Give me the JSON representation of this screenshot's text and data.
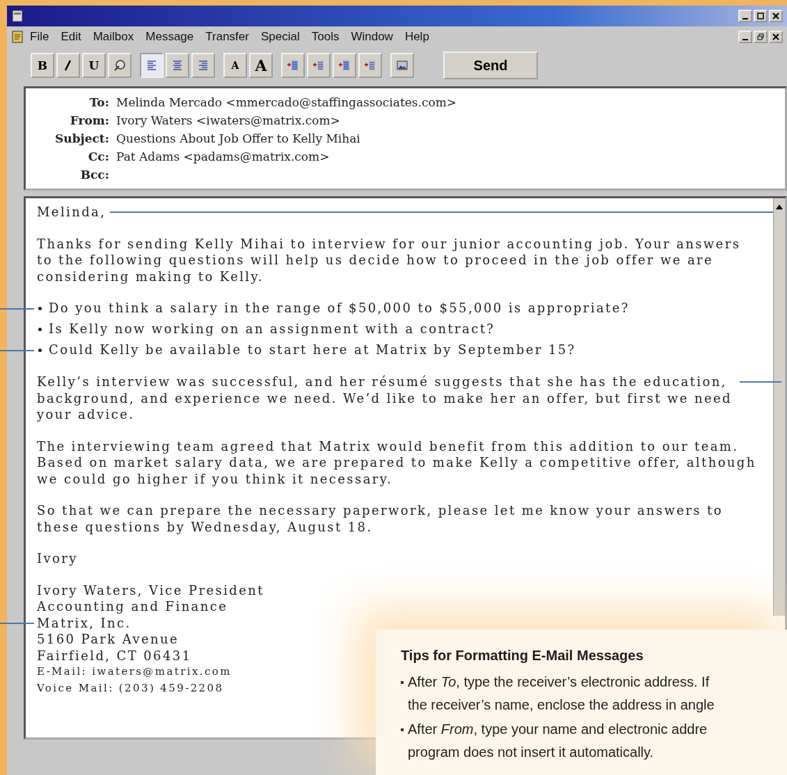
{
  "menu": [
    "File",
    "Edit",
    "Mailbox",
    "Message",
    "Transfer",
    "Special",
    "Tools",
    "Window",
    "Help"
  ],
  "toolbar": {
    "groups": [
      [
        {
          "kind": "text",
          "label": "B"
        },
        {
          "kind": "icon"
        },
        {
          "kind": "text",
          "label": "U"
        },
        {
          "kind": "icon"
        }
      ],
      [
        {
          "kind": "icon",
          "selected": true
        },
        {
          "kind": "icon",
          "selected": false
        },
        {
          "kind": "icon",
          "selected": false
        }
      ],
      [
        {
          "kind": "text",
          "label": "A"
        },
        {
          "kind": "text",
          "label": "A"
        }
      ],
      [
        {
          "kind": "icon"
        },
        {
          "kind": "icon"
        },
        {
          "kind": "icon"
        },
        {
          "kind": "icon"
        }
      ],
      [
        {
          "kind": "icon"
        }
      ]
    ],
    "send_button": "Send"
  },
  "headers": [
    {
      "label": "To:",
      "value": "Melinda Mercado <mmercado@staffingassociates.com>"
    },
    {
      "label": "From:",
      "value": "Ivory Waters <iwaters@matrix.com>"
    },
    {
      "label": "Subject:",
      "value": "Questions About Job Offer to Kelly Mihai"
    },
    {
      "label": "Cc:",
      "value": "Pat Adams <padams@matrix.com>"
    },
    {
      "label": "Bcc:"
    }
  ],
  "body": [
    {
      "kind": "greeting",
      "text": "Melinda,",
      "leader": true
    },
    {
      "kind": "paragraph",
      "leader": false,
      "text": "Thanks for sending Kelly Mihai to interview for our junior accounting job. Your answers to the following questions will help us decide how to proceed in the job offer we are considering making to Kelly."
    },
    {
      "kind": "bullets",
      "items": [
        {
          "text": "Do you think a salary in the range of $50,000 to $55,000 is appropriate?",
          "leader": true
        },
        {
          "text": "Is Kelly now working on an assignment with a contract?",
          "leader": false
        },
        {
          "text": "Could Kelly be available to start here at Matrix by September 15?",
          "leader": true
        }
      ]
    },
    {
      "kind": "paragraph",
      "text": "Kelly’s interview was successful, and her résumé suggests that she has the education, background, and experience we need. We’d like to make her an offer, but first we need your advice.",
      "leader": true
    },
    {
      "kind": "paragraph",
      "leader": false,
      "text": "The interviewing team agreed that Matrix would benefit from this addition to our team. Based on market salary data, we are prepared to make Kelly a competitive offer, although we could go higher if you think it necessary."
    },
    {
      "kind": "paragraph",
      "leader": false,
      "text": "So that we can prepare the necessary paperwork, please let me know your answers to these questions by Wednesday, August 18."
    },
    {
      "kind": "paragraph",
      "leader": false,
      "text": "Ivory"
    },
    {
      "kind": "signature",
      "lines": [
        {
          "text": "Ivory Waters, Vice President",
          "small": false,
          "leader": false
        },
        {
          "text": "Accounting and Finance",
          "small": false,
          "leader": false
        },
        {
          "text": "Matrix, Inc.",
          "small": false,
          "leader": true
        },
        {
          "text": "5160 Park Avenue",
          "small": false,
          "leader": false
        },
        {
          "text": "Fairfield, CT 06431",
          "small": false,
          "leader": false
        },
        {
          "text": "E-Mail: iwaters@matrix.com",
          "small": true,
          "leader": false
        },
        {
          "text": "Voice Mail: (203) 459-2208",
          "small": true,
          "leader": false
        }
      ]
    }
  ],
  "tips": {
    "title": "Tips for Formatting E-Mail Messages",
    "items": [
      {
        "lines": [
          "After *To*, type the receiver’s electronic address. If",
          "the receiver’s name, enclose the address in angle"
        ]
      },
      {
        "lines": [
          "After *From*, type your name and electronic addre",
          "program does not insert it automatically."
        ]
      }
    ]
  }
}
